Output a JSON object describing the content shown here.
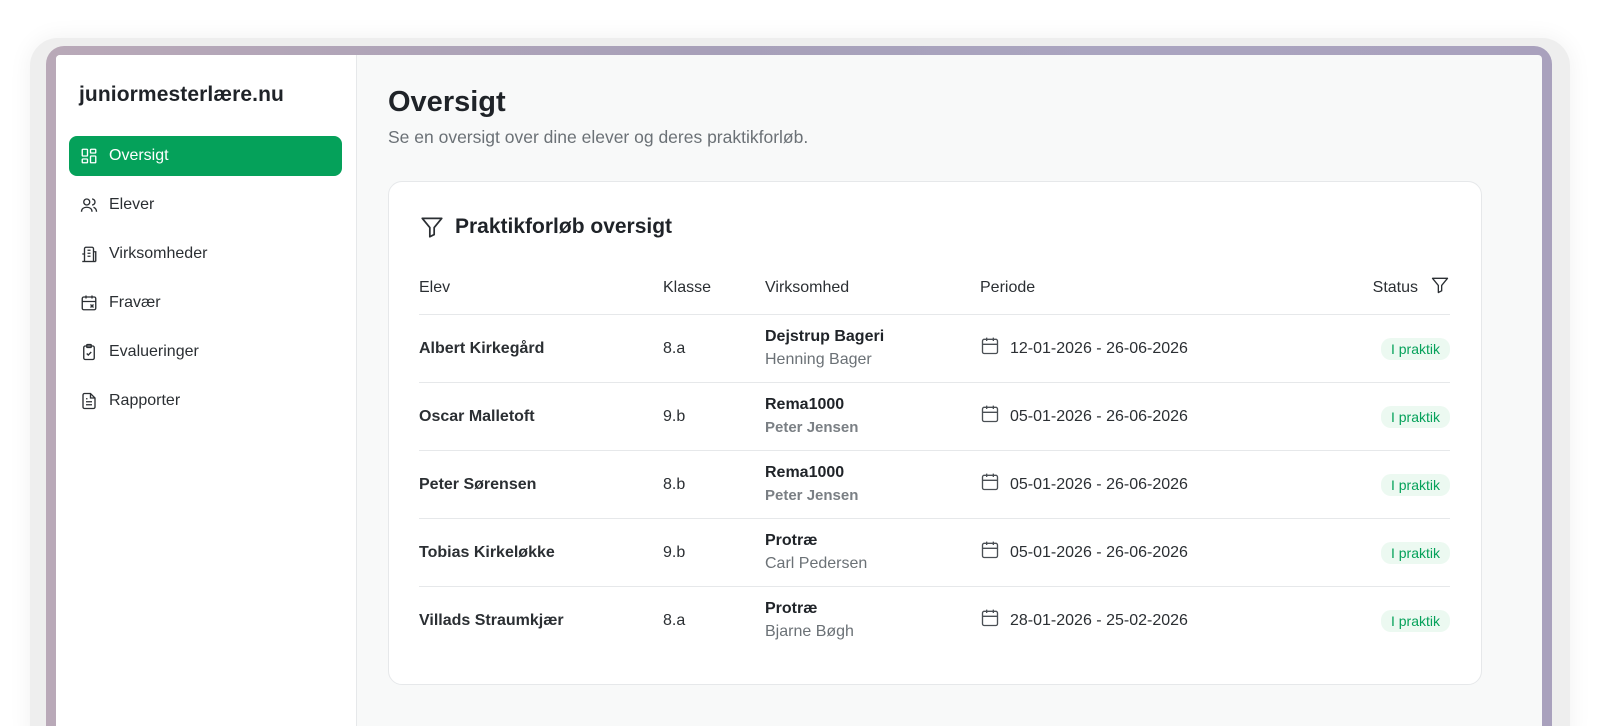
{
  "app": {
    "brand": "juniormesterlære.nu"
  },
  "colors": {
    "accent": "#05a15a",
    "badge_bg": "#ecf9f1"
  },
  "sidebar": {
    "items": [
      {
        "label": "Oversigt",
        "icon": "dashboard-icon",
        "active": true
      },
      {
        "label": "Elever",
        "icon": "users-icon",
        "active": false
      },
      {
        "label": "Virksomheder",
        "icon": "building-icon",
        "active": false
      },
      {
        "label": "Fravær",
        "icon": "calendar-x-icon",
        "active": false
      },
      {
        "label": "Evalueringer",
        "icon": "clipboard-check-icon",
        "active": false
      },
      {
        "label": "Rapporter",
        "icon": "file-text-icon",
        "active": false
      }
    ]
  },
  "main": {
    "title": "Oversigt",
    "subtitle": "Se en oversigt over dine elever og deres praktikforløb.",
    "card": {
      "title": "Praktikforløb oversigt",
      "icon": "filter-icon",
      "columns": [
        "Elev",
        "Klasse",
        "Virksomhed",
        "Periode",
        "Status"
      ],
      "rows": [
        {
          "elev": "Albert Kirkegård",
          "klasse": "8.a",
          "virksomhed": "Dejstrup Bageri",
          "kontakt": "Henning Bager",
          "periode": "12-01-2026 - 26-06-2026",
          "status": "I praktik"
        },
        {
          "elev": "Oscar Malletoft",
          "klasse": "9.b",
          "virksomhed": "Rema1000",
          "kontakt": "Peter Jensen",
          "periode": "05-01-2026 - 26-06-2026",
          "status": "I praktik"
        },
        {
          "elev": "Peter Sørensen",
          "klasse": "8.b",
          "virksomhed": "Rema1000",
          "kontakt": "Peter Jensen",
          "periode": "05-01-2026 - 26-06-2026",
          "status": "I praktik"
        },
        {
          "elev": "Tobias Kirkeløkke",
          "klasse": "9.b",
          "virksomhed": "Protræ",
          "kontakt": "Carl Pedersen",
          "periode": "05-01-2026 - 26-06-2026",
          "status": "I praktik"
        },
        {
          "elev": "Villads Straumkjær",
          "klasse": "8.a",
          "virksomhed": "Protræ",
          "kontakt": "Bjarne Bøgh",
          "periode": "28-01-2026 - 25-02-2026",
          "status": "I praktik"
        }
      ]
    }
  }
}
